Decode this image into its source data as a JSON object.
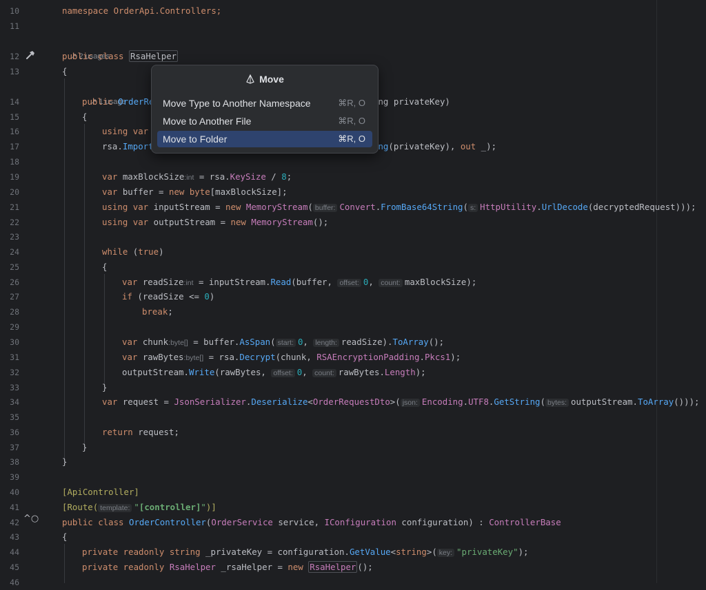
{
  "popup": {
    "title": "Move",
    "items": [
      {
        "label": "Move Type to Another Namespace",
        "shortcut": "⌘R, O",
        "selected": false
      },
      {
        "label": "Move to Another File",
        "shortcut": "⌘R, O",
        "selected": false
      },
      {
        "label": "Move to Folder",
        "shortcut": "⌘R, O",
        "selected": true
      }
    ]
  },
  "line_numbers": [
    "10",
    "11",
    "12",
    "13",
    "14",
    "15",
    "16",
    "17",
    "18",
    "19",
    "20",
    "21",
    "22",
    "23",
    "24",
    "25",
    "26",
    "27",
    "28",
    "29",
    "30",
    "31",
    "32",
    "33",
    "34",
    "35",
    "36",
    "37",
    "38",
    "39",
    "40",
    "41",
    "42",
    "43",
    "44",
    "45",
    "46"
  ],
  "usages": {
    "class_usages": "2 usages",
    "ctor_usages": "1 usage"
  },
  "code": {
    "l10_ns": "namespace OrderApi.Controllers;",
    "l12_kw": "public class ",
    "l12_name": "RsaHelper",
    "l13": "{",
    "l14_kw": "public ",
    "l14_name": "OrderRe",
    "l14_tail": "ing privateKey)",
    "l15": "{",
    "l16_kw": "using var",
    "l17_a": "rsa.",
    "l17_b": "Import",
    "l17_c": "ing",
    "l17_d": "(privateKey), ",
    "l17_e": "out",
    "l17_f": " _);",
    "l19_var": "var ",
    "l19_id": "maxBlockSize",
    "l19_hint": ":int",
    "l19_a": " = rsa.",
    "l19_b": "KeySize",
    "l19_c": " / ",
    "l19_d": "8",
    "l19_e": ";",
    "l20_var": "var ",
    "l20_a": "buffer = ",
    "l20_new": "new ",
    "l20_byte": "byte",
    "l20_b": "[maxBlockSize];",
    "l21_using": "using var ",
    "l21_a": "inputStream = ",
    "l21_new": "new ",
    "l21_cls": "MemoryStream",
    "l21_p": "(",
    "l21_hint": "buffer:",
    "l21_cv": "Convert",
    "l21_dot": ".",
    "l21_m": "FromBase64String",
    "l21_p2": "(",
    "l21_hint2": "s:",
    "l21_hu": "HttpUtility",
    "l21_dot2": ".",
    "l21_ud": "UrlDecode",
    "l21_end": "(decryptedRequest)));",
    "l22_using": "using var ",
    "l22_a": "outputStream = ",
    "l22_new": "new ",
    "l22_cls": "MemoryStream",
    "l22_end": "();",
    "l24_while": "while ",
    "l24_p": "(",
    "l24_true": "true",
    "l24_end": ")",
    "l25": "{",
    "l26_var": "var ",
    "l26_id": "readSize",
    "l26_hint": ":int",
    "l26_a": " = inputStream.",
    "l26_m": "Read",
    "l26_b": "(buffer, ",
    "l26_h1": "offset:",
    "l26_n": "0",
    "l26_c": ", ",
    "l26_h2": "count:",
    "l26_d": "maxBlockSize);",
    "l27_if": "if ",
    "l27_a": "(readSize <= ",
    "l27_n": "0",
    "l27_b": ")",
    "l28_break": "break",
    "l28_semi": ";",
    "l30_var": "var ",
    "l30_id": "chunk",
    "l30_hint": ":byte[]",
    "l30_a": " = buffer.",
    "l30_m": "AsSpan",
    "l30_b": "(",
    "l30_h1": "start:",
    "l30_n": "0",
    "l30_c": ", ",
    "l30_h2": "length:",
    "l30_d": "readSize).",
    "l30_m2": "ToArray",
    "l30_e": "();",
    "l31_var": "var ",
    "l31_id": "rawBytes",
    "l31_hint": ":byte[]",
    "l31_a": " = rsa.",
    "l31_m": "Decrypt",
    "l31_b": "(chunk, ",
    "l31_cls": "RSAEncryptionPadding",
    "l31_dot": ".",
    "l31_p": "Pkcs1",
    "l31_e": ");",
    "l32_a": "outputStream.",
    "l32_m": "Write",
    "l32_b": "(rawBytes, ",
    "l32_h1": "offset:",
    "l32_n": "0",
    "l32_c": ", ",
    "l32_h2": "count:",
    "l32_d": "rawBytes.",
    "l32_p": "Length",
    "l32_e": ");",
    "l33": "}",
    "l34_var": "var ",
    "l34_a": "request = ",
    "l34_cls": "JsonSerializer",
    "l34_dot": ".",
    "l34_m": "Deserialize",
    "l34_lt": "<",
    "l34_t": "OrderRequestDto",
    "l34_gt": ">(",
    "l34_h1": "json:",
    "l34_enc": "Encoding",
    "l34_dot2": ".",
    "l34_utf": "UTF8",
    "l34_dot3": ".",
    "l34_gs": "GetString",
    "l34_p": "(",
    "l34_h2": "bytes:",
    "l34_b": "outputStream.",
    "l34_ta": "ToArray",
    "l34_e": "()));",
    "l36_ret": "return",
    "l36_a": " request;",
    "l37": "}",
    "l38": "}",
    "l40": "[ApiController]",
    "l41_a": "[Route(",
    "l41_h": "template:",
    "l41_s1": "\"",
    "l41_s2": "[controller]",
    "l41_s3": "\"",
    "l41_b": ")]",
    "l42_kw": "public class ",
    "l42_cls": "OrderController",
    "l42_a": "(",
    "l42_t1": "OrderService",
    "l42_b": " service, ",
    "l42_t2": "IConfiguration",
    "l42_c": " configuration) : ",
    "l42_t3": "ControllerBase",
    "l43": "{",
    "l44_kw": "private readonly ",
    "l44_t": "string",
    "l44_a": " _privateKey = configuration.",
    "l44_m": "GetValue",
    "l44_lt": "<",
    "l44_t2": "string",
    "l44_gt": ">(",
    "l44_h": "key:",
    "l44_s": "\"privateKey\"",
    "l44_e": ");",
    "l45_kw": "private readonly ",
    "l45_t": "RsaHelper",
    "l45_a": " _rsaHelper = ",
    "l45_new": "new ",
    "l45_t2": "RsaHelper",
    "l45_e": "();"
  }
}
